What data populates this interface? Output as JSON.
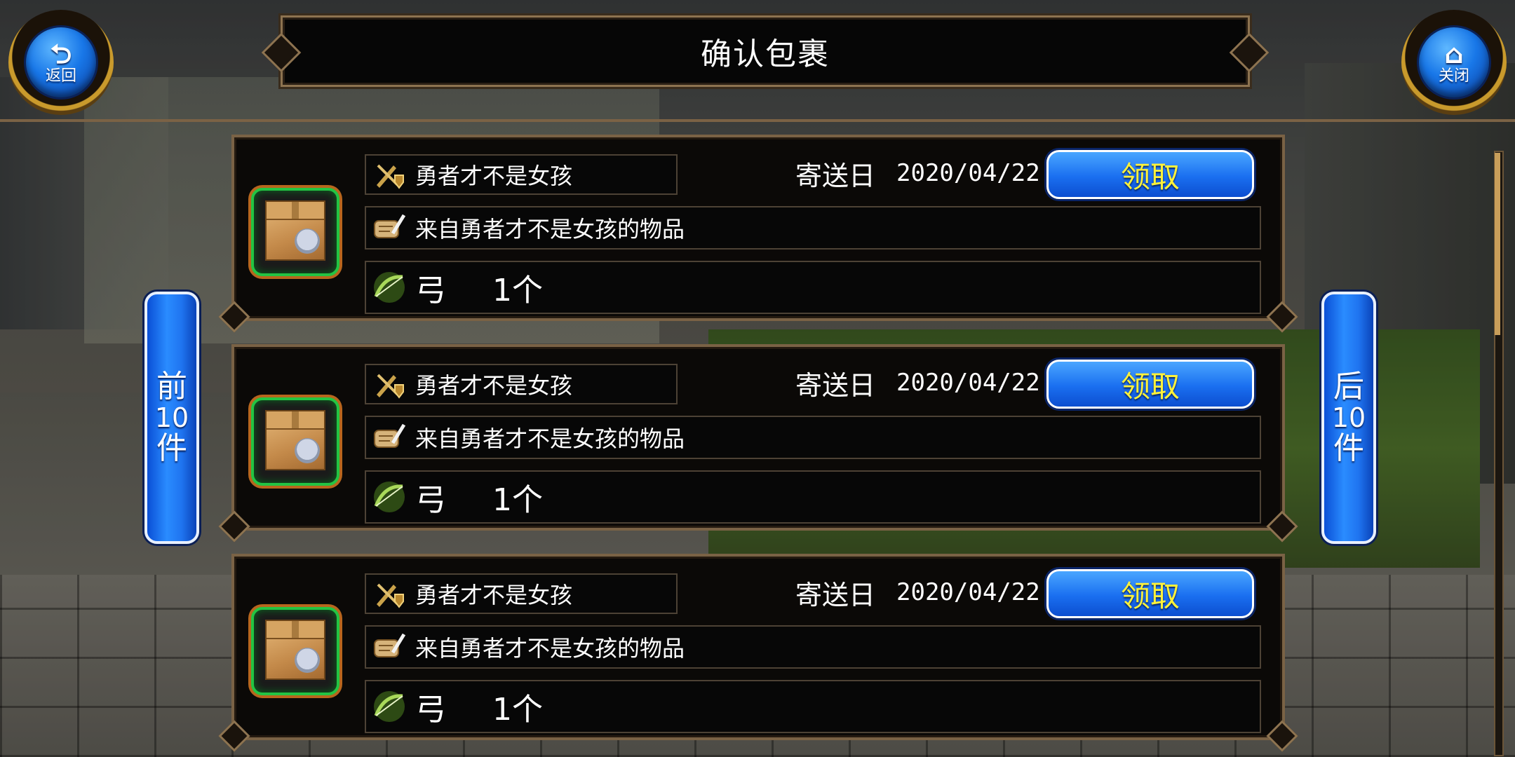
{
  "header": {
    "title": "确认包裹",
    "back_label": "返回",
    "close_label": "关闭"
  },
  "paging": {
    "prev": {
      "top": "前",
      "num": "10",
      "bottom": "件"
    },
    "next": {
      "top": "后",
      "num": "10",
      "bottom": "件"
    }
  },
  "parcels": [
    {
      "sender": "勇者才不是女孩",
      "date_label": "寄送日",
      "date": "2020/04/22",
      "claim_label": "领取",
      "message": "来自勇者才不是女孩的物品",
      "item_name": "弓",
      "item_qty": "1个"
    },
    {
      "sender": "勇者才不是女孩",
      "date_label": "寄送日",
      "date": "2020/04/22",
      "claim_label": "领取",
      "message": "来自勇者才不是女孩的物品",
      "item_name": "弓",
      "item_qty": "1个"
    },
    {
      "sender": "勇者才不是女孩",
      "date_label": "寄送日",
      "date": "2020/04/22",
      "claim_label": "领取",
      "message": "来自勇者才不是女孩的物品",
      "item_name": "弓",
      "item_qty": "1个"
    }
  ],
  "colors": {
    "claim_text": "#fff23a",
    "button_blue": "#1a6ff0",
    "frame_gold": "#8d7350",
    "parcel_border": "#23c443"
  },
  "icons": {
    "back": "back-arrow-icon",
    "close": "home-icon",
    "sender": "sword-shield-icon",
    "message": "scroll-quill-icon",
    "item": "bow-icon",
    "parcel": "parcel-box-icon"
  }
}
